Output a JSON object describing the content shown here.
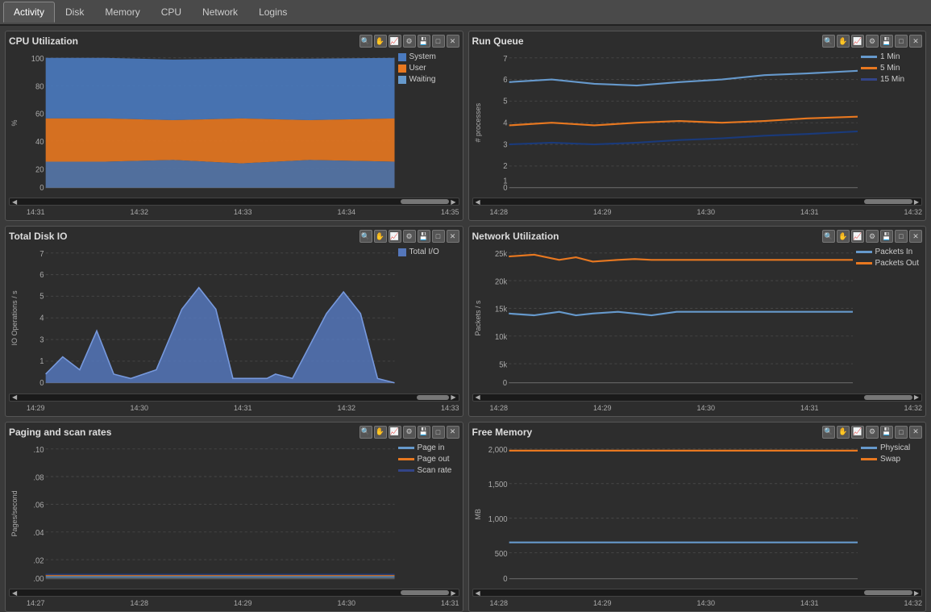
{
  "tabs": [
    {
      "label": "Activity",
      "active": true
    },
    {
      "label": "Disk",
      "active": false
    },
    {
      "label": "Memory",
      "active": false
    },
    {
      "label": "CPU",
      "active": false
    },
    {
      "label": "Network",
      "active": false
    },
    {
      "label": "Logins",
      "active": false
    }
  ],
  "panels": {
    "cpu_util": {
      "title": "CPU Utilization",
      "y_label": "%",
      "x_labels": [
        "14:31",
        "14:32",
        "14:33",
        "14:34",
        "14:35"
      ],
      "legend": [
        {
          "color": "#4a7abf",
          "label": "System"
        },
        {
          "color": "#e87820",
          "label": "User"
        },
        {
          "color": "#6699cc",
          "label": "Waiting"
        }
      ]
    },
    "run_queue": {
      "title": "Run Queue",
      "y_label": "# processes",
      "x_labels": [
        "14:28",
        "14:29",
        "14:30",
        "14:31",
        "14:32"
      ],
      "legend": [
        {
          "color": "#6699cc",
          "label": "1 Min"
        },
        {
          "color": "#e87820",
          "label": "5 Min"
        },
        {
          "color": "#1a3a6a",
          "label": "15 Min"
        }
      ]
    },
    "disk_io": {
      "title": "Total Disk IO",
      "y_label": "IO Operations / s",
      "x_labels": [
        "14:29",
        "14:30",
        "14:31",
        "14:32",
        "14:33"
      ],
      "legend": [
        {
          "color": "#5577bb",
          "label": "Total I/O"
        }
      ]
    },
    "network_util": {
      "title": "Network Utilization",
      "y_label": "Packets / s",
      "x_labels": [
        "14:28",
        "14:29",
        "14:30",
        "14:31",
        "14:32"
      ],
      "legend": [
        {
          "color": "#6699cc",
          "label": "Packets In"
        },
        {
          "color": "#e87820",
          "label": "Packets Out"
        }
      ]
    },
    "paging": {
      "title": "Paging and scan rates",
      "y_label": "Pages/second",
      "x_labels": [
        "14:27",
        "14:28",
        "14:29",
        "14:30",
        "14:31"
      ],
      "legend": [
        {
          "color": "#6699cc",
          "label": "Page in"
        },
        {
          "color": "#e87820",
          "label": "Page out"
        },
        {
          "color": "#1a3a6a",
          "label": "Scan rate"
        }
      ]
    },
    "free_memory": {
      "title": "Free Memory",
      "y_label": "MB",
      "x_labels": [
        "14:28",
        "14:29",
        "14:30",
        "14:31",
        "14:32"
      ],
      "legend": [
        {
          "color": "#6699cc",
          "label": "Physical"
        },
        {
          "color": "#e87820",
          "label": "Swap"
        }
      ]
    }
  }
}
